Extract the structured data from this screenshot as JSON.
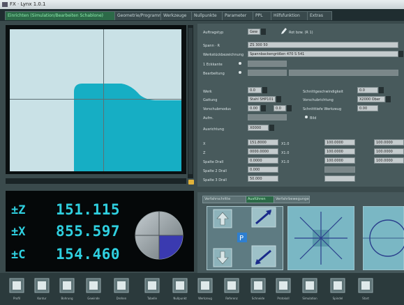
{
  "window": {
    "title": "FX · Lynx 1.0.1"
  },
  "tabs": [
    {
      "label": "Einrichten (Simulation/Bearbeiten Schablone)"
    },
    {
      "label": "Geometrie/Programm"
    },
    {
      "label": "Werkzeuge"
    },
    {
      "label": "Nullpunkte"
    },
    {
      "label": "Parameter"
    },
    {
      "label": "PPL"
    },
    {
      "label": "Hilfsfunktion"
    },
    {
      "label": "Extras"
    }
  ],
  "dro": {
    "z": {
      "symbol": "±Z",
      "value": "151.115"
    },
    "x": {
      "symbol": "±X",
      "value": "855.597"
    },
    "c": {
      "symbol": "±C",
      "value": "154.460"
    }
  },
  "form": {
    "row1_label": "Auftragstyp",
    "row1_value": "Gew",
    "row1_note": "Rot bzw. (R 1)",
    "row2_label": "Spann · R",
    "row2_value": "ZS 300 50",
    "row3_label": "Werkstückbezeichnung",
    "row3_value": "Spannbackengrößen 470 S 541",
    "row4_label": "1 Eckkante",
    "row5_label": "Bearbeitung",
    "r6_label": "Werk",
    "r6_val": "0.0",
    "r6_mid_label": "Schnittgeschwindigkeit",
    "r6_right_val": "0.0",
    "r7_label": "Gattung",
    "r7_val": "Stahl SHP101",
    "r7_mid_label": "Vorschubrichtung",
    "r7_right_val": "X2000 Ober",
    "r8_label": "Vorschubmodus",
    "r8_val": "0.00",
    "r8_val2": "0.0",
    "r8_mid_label": "Schnitttiefe Werkzeug",
    "r8_right_val": "0.00",
    "r9_label": "Aufm.",
    "r9_mid_label": "Bild",
    "r10_label": "Ausrichtung",
    "r10_val": "X0000",
    "g_label1": "X",
    "g_label2": "Z",
    "g_label3": "Spalte Drall",
    "g_label4": "Spalte 2 Drall",
    "g_label5": "Spalte 3 Drall",
    "g1a": "151.8000",
    "g1b": "X1.0",
    "g1c": "100.0000",
    "g1d": "100.0000",
    "g2a": "0000.0000",
    "g2b": "X1.0",
    "g2c": "100.0000",
    "g2d": "100.0000",
    "g3a": "0.0000",
    "g3b": "X1.0",
    "g3c": "100.0000",
    "g3d": "100.0000",
    "g4a": "0.000",
    "g5a": "50.000"
  },
  "bottom_tabs": [
    {
      "label": "Verfahrschritte"
    },
    {
      "label": "Ausführen"
    },
    {
      "label": "Verfahrbewegungen"
    }
  ],
  "toolbar": [
    {
      "label": "Profil"
    },
    {
      "label": "Kontur"
    },
    {
      "label": "Bohrung"
    },
    {
      "label": "Gewinde"
    },
    {
      "label": "Drehen"
    },
    {
      "label": "Tabelle"
    },
    {
      "label": "Nullpunkt"
    },
    {
      "label": "Werkzeug"
    },
    {
      "label": "Referenz"
    },
    {
      "label": "Schneide"
    },
    {
      "label": "Protokoll"
    },
    {
      "label": "Simulation"
    },
    {
      "label": "Spindel"
    },
    {
      "label": "Start"
    },
    {
      "label": "Position"
    },
    {
      "label": "Weiter"
    }
  ],
  "colors": {
    "accent": "#2fd0e0",
    "workpiece": "#16aec4",
    "active_tab": "#2c6a48",
    "marker": "#e1b23a"
  }
}
